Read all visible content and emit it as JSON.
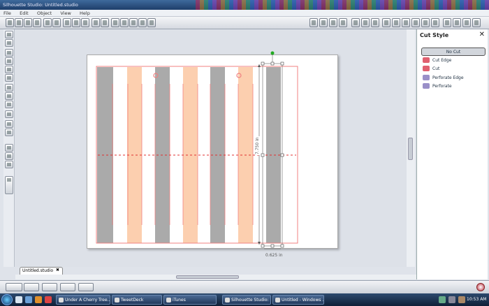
{
  "window": {
    "title": "Silhouette Studio: Untitled.studio"
  },
  "menu": [
    "File",
    "Edit",
    "Object",
    "View",
    "Help"
  ],
  "panel": {
    "title": "Cut Style",
    "close": "✕",
    "items": [
      {
        "label": "No Cut",
        "selected": true,
        "color": "#d2d6dc"
      },
      {
        "label": "Cut Edge",
        "selected": false,
        "color": "#e06070"
      },
      {
        "label": "Cut",
        "selected": false,
        "color": "#e06070"
      },
      {
        "label": "Perforate Edge",
        "selected": false,
        "color": "#9a8fc8"
      },
      {
        "label": "Perforate",
        "selected": false,
        "color": "#9a8fc8"
      }
    ]
  },
  "canvas": {
    "dimension_v": "7.750 in",
    "dimension_h": "0.625 in",
    "stripe_colors": {
      "gray": "#aaaaaa",
      "peach": "#fccfaf",
      "cutline": "#f08080"
    }
  },
  "document_tab": {
    "label": "Untitled.studio",
    "close": "✖"
  },
  "taskbar": {
    "tasks": [
      "Under A Cherry Tree...",
      "TweetDeck",
      "iTunes",
      "Silhouette Studio: U...",
      "Untitled - Windows ..."
    ],
    "clock": "10:53 AM"
  }
}
